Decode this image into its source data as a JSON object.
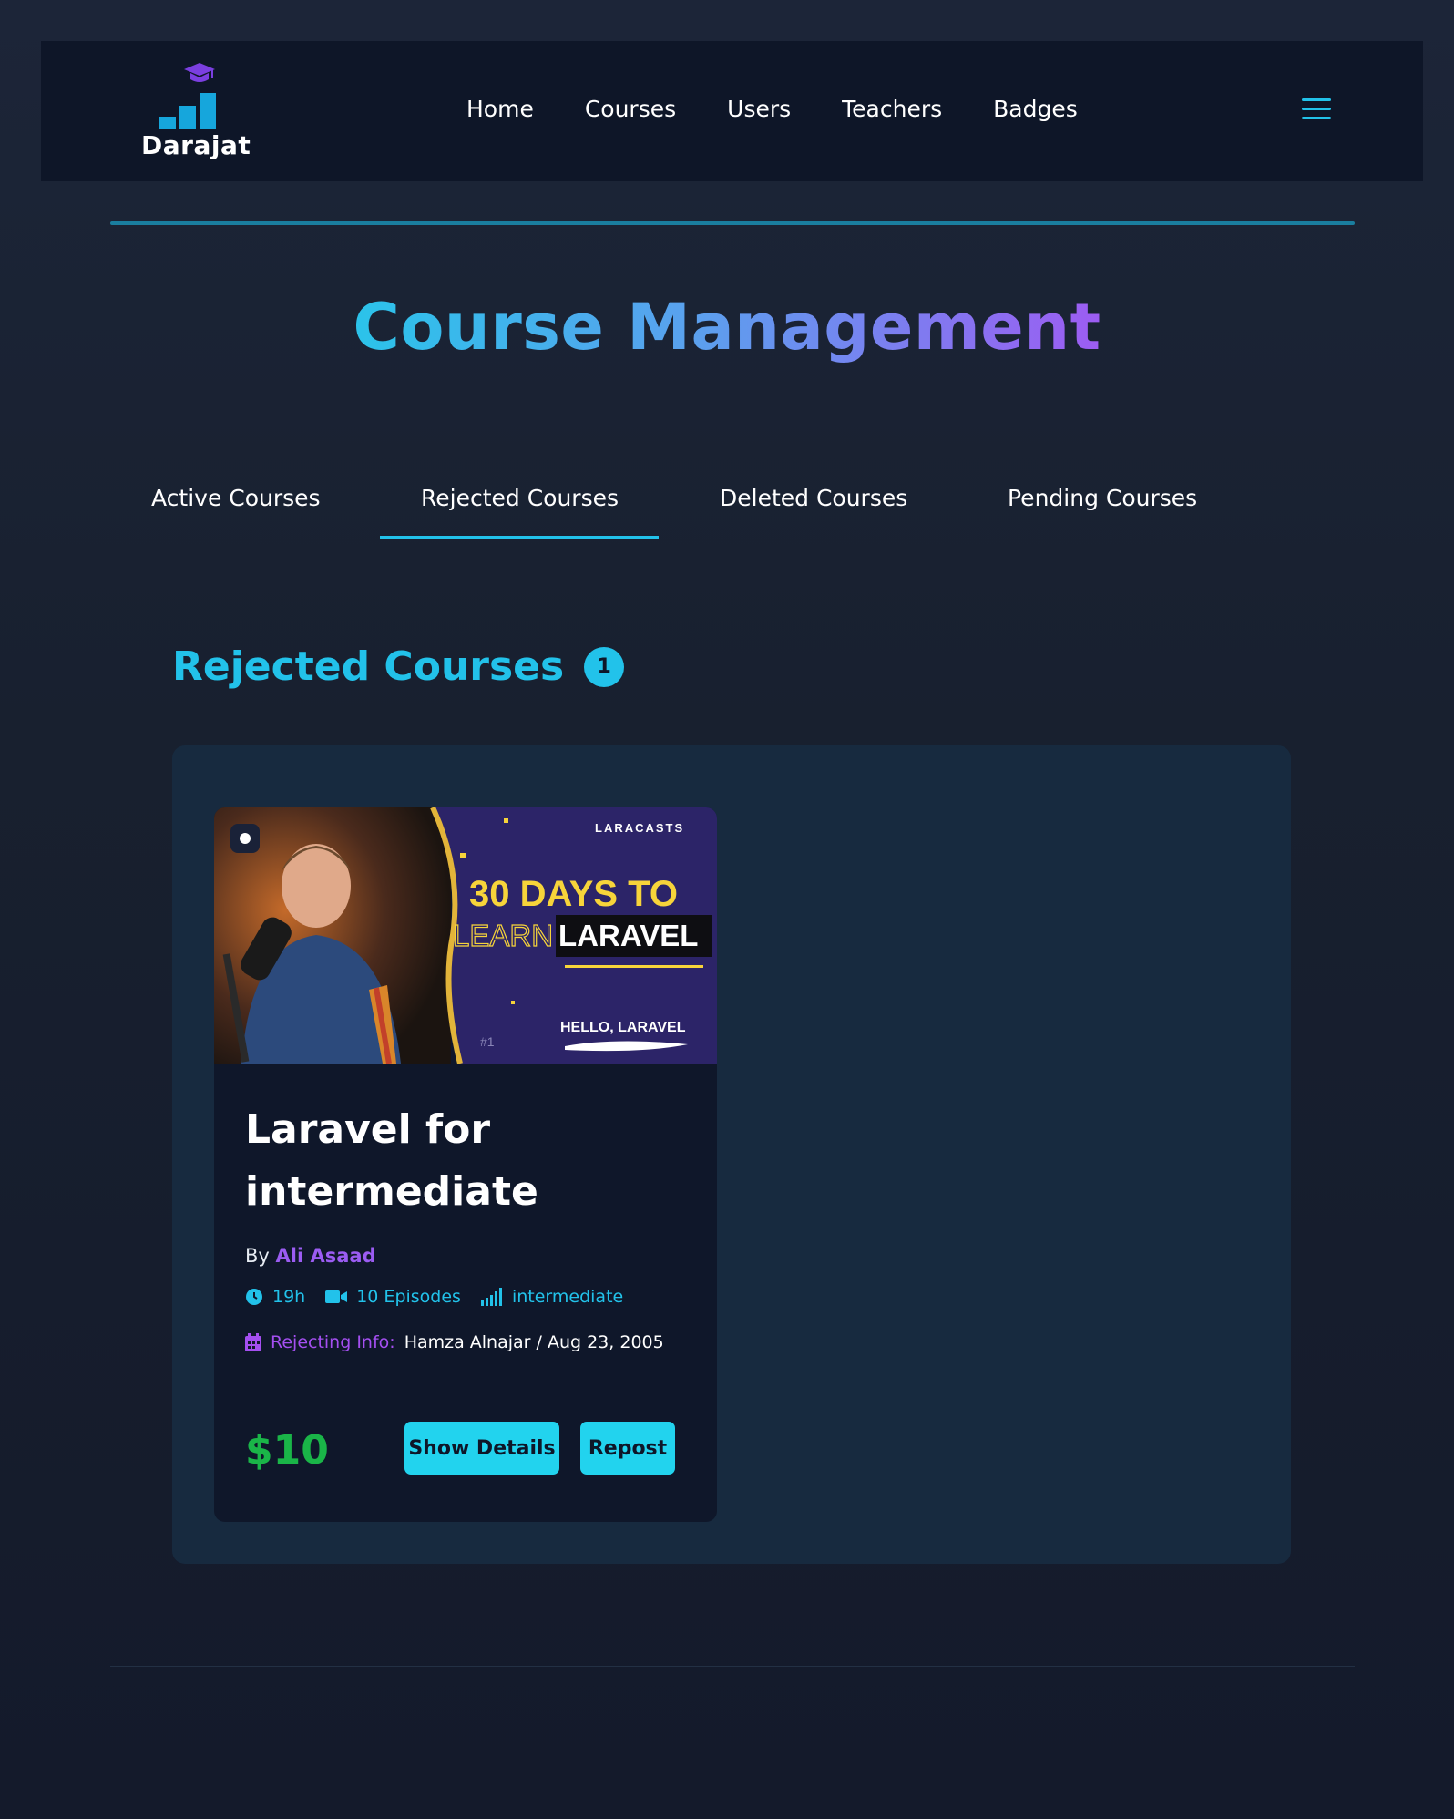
{
  "brand": {
    "name": "Darajat"
  },
  "nav": {
    "links": [
      "Home",
      "Courses",
      "Users",
      "Teachers",
      "Badges"
    ]
  },
  "page": {
    "title": "Course Management"
  },
  "tabs": [
    "Active Courses",
    "Rejected Courses",
    "Deleted Courses",
    "Pending Courses"
  ],
  "active_tab": "Rejected Courses",
  "section": {
    "title": "Rejected Courses",
    "count": "1"
  },
  "course": {
    "thumbnail": {
      "brand": "LARACASTS",
      "line1": "30 DAYS TO",
      "line2_outline": "LEARN",
      "line2_solid": "LARAVEL",
      "episode_title": "HELLO, LARAVEL",
      "episode_tag": "#1"
    },
    "title": "Laravel for intermediate",
    "author_prefix": "By",
    "author": "Ali Asaad",
    "duration": "19h",
    "episodes": "10 Episodes",
    "level": "intermediate",
    "rejecting_label": "Rejecting Info:",
    "rejecting_value": "Hamza Alnajar / Aug 23, 2005",
    "price": "$10",
    "show_details_label": "Show Details",
    "repost_label": "Repost"
  },
  "colors": {
    "accent": "#22c2ea",
    "purple": "#9b5cf2",
    "price": "#1ab548",
    "navbar": "#0e1628",
    "panel": "#172a3f"
  }
}
